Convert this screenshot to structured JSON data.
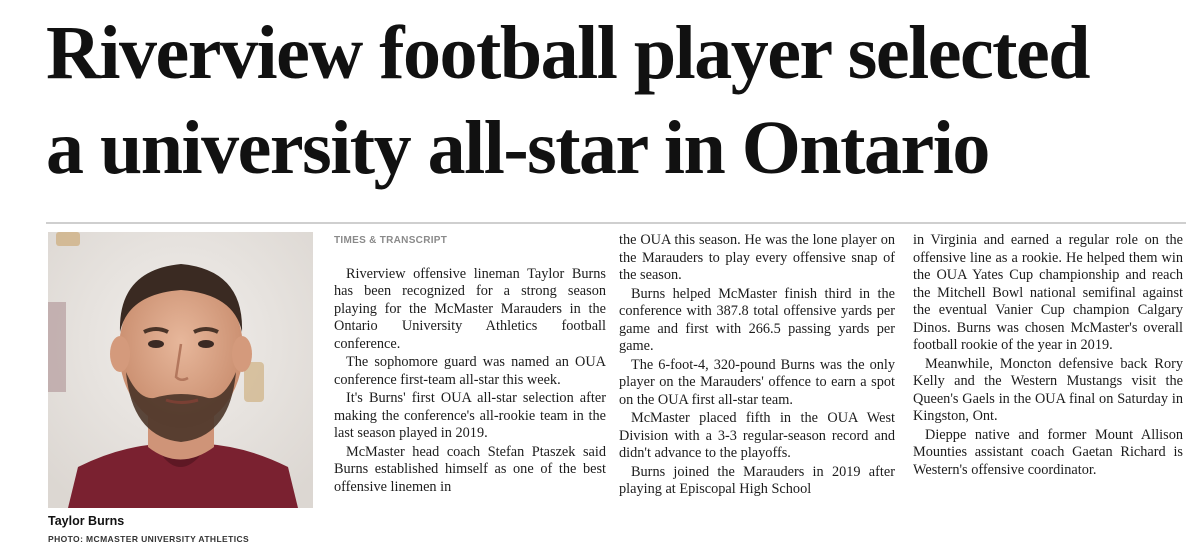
{
  "headline": {
    "line1": "Riverview football player selected",
    "line2": "a university all-star in Ontario"
  },
  "source": "TIMES & TRANSCRIPT",
  "photo": {
    "caption_name": "Taylor Burns",
    "caption_credit": "PHOTO: MCMASTER UNIVERSITY ATHLETICS"
  },
  "columns": {
    "col1": [
      "Riverview offensive lineman Taylor Burns has been recognized for a strong season playing for the McMaster Marauders in the Ontario University Athletics football conference.",
      "The sophomore guard was named an OUA conference first-team all-star this week.",
      "It's Burns' first OUA all-star selection after making the conference's all-rookie team in the last season played in 2019.",
      "McMaster head coach Stefan Ptaszek said Burns established himself as one of the best offensive linemen in"
    ],
    "col2": [
      "the OUA this season. He was the lone player on the Marauders to play every offensive snap of the season.",
      "Burns helped McMaster finish third in the conference with 387.8 total offensive yards per game and first with 266.5 passing yards per game.",
      "The 6-foot-4, 320-pound Burns was the only player on the Marauders' offence to earn a spot on the OUA first all-star team.",
      "McMaster placed fifth in the OUA West Division with a 3-3 regular-season record and didn't advance to the playoffs.",
      "Burns joined the Marauders in 2019 after playing at Episcopal High School"
    ],
    "col3": [
      "in Virginia and earned a regular role on the offensive line as a rookie. He helped them win the OUA Yates Cup championship and reach the Mitchell Bowl national semifinal against the eventual Vanier Cup champion Calgary Dinos. Burns was chosen McMaster's overall football rookie of the year in 2019.",
      "Meanwhile, Moncton defensive back Rory Kelly and the Western Mustangs visit the Queen's Gaels in the OUA final on Saturday in Kingston, Ont.",
      "Dieppe native and former Mount Allison Mounties assistant coach Gaetan Richard is Western's offensive coordinator."
    ]
  }
}
